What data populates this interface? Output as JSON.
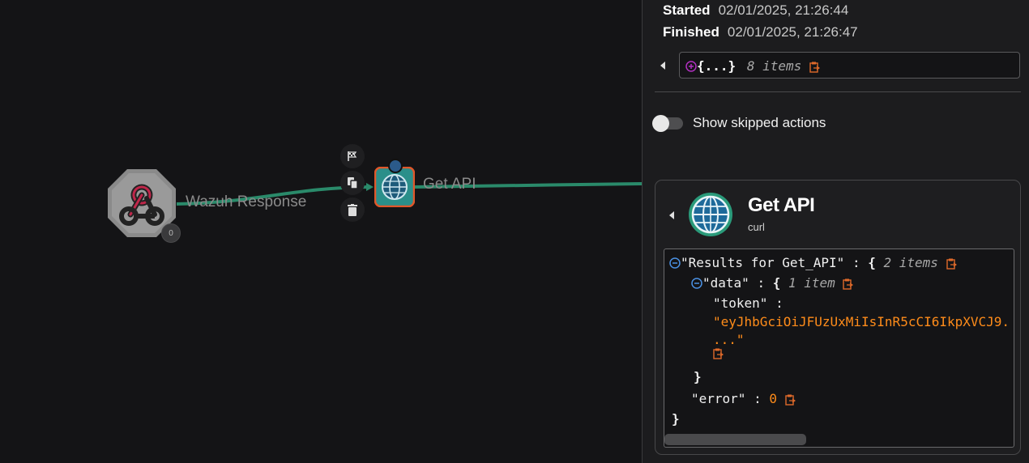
{
  "workflow": {
    "nodes": [
      {
        "label": "Wazuh Response",
        "icon": "webhook-icon",
        "badge": "0"
      },
      {
        "label": "Get API",
        "icon": "globe-icon"
      }
    ],
    "node_tools": [
      "flag-icon",
      "copy-icon",
      "trash-icon"
    ],
    "edge_color": "#2a8a6a"
  },
  "panel": {
    "started_label": "Started",
    "started_value": "02/01/2025, 21:26:44",
    "finished_label": "Finished",
    "finished_value": "02/01/2025, 21:26:47",
    "top_json": {
      "brace": "{...}",
      "count": "8 items"
    },
    "toggle": {
      "label": "Show skipped actions",
      "on": false
    },
    "result": {
      "title": "Get API",
      "subtitle": "curl",
      "json": {
        "root_key": "\"Results for Get_API\"",
        "root_count": "2 items",
        "data_key": "\"data\"",
        "data_count": "1 item",
        "token_key": "\"token\"",
        "token_value": "\"eyJhbGciOiJFUzUxMiIsInR5cCI6IkpXVCJ9.",
        "token_cont": "...\"",
        "error_key": "\"error\"",
        "error_value": "0",
        "colon": ":",
        "open_brace": "{",
        "close_brace": "}"
      }
    }
  },
  "colors": {
    "accent_orange": "#ff8c1a",
    "accent_purple": "#b030c0",
    "accent_blue": "#4a90e2"
  }
}
